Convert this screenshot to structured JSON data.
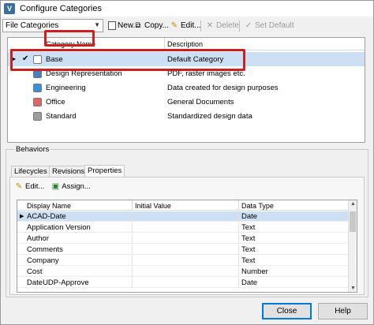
{
  "window": {
    "title": "Configure Categories",
    "app_icon": "vault-icon"
  },
  "toolbar": {
    "combo_value": "File Categories",
    "new_label": "New...",
    "copy_label": "Copy...",
    "edit_label": "Edit...",
    "delete_label": "Delete",
    "set_default_label": "Set Default"
  },
  "categories": {
    "headers": [
      "Category Name",
      "Description"
    ],
    "rows": [
      {
        "name": "Base",
        "description": "Default Category",
        "color": "#ffffff",
        "selected": true
      },
      {
        "name": "Design Representation",
        "description": "PDF, raster images etc.",
        "color": "#4a7ebf",
        "selected": false
      },
      {
        "name": "Engineering",
        "description": "Data created for design purposes",
        "color": "#3b8fd6",
        "selected": false
      },
      {
        "name": "Office",
        "description": "General Documents",
        "color": "#e06666",
        "selected": false
      },
      {
        "name": "Standard",
        "description": "Standardized design data",
        "color": "#9e9e9e",
        "selected": false
      }
    ]
  },
  "behaviors": {
    "legend": "Behaviors",
    "tabs": [
      "Lifecycles",
      "Revisions",
      "Properties"
    ],
    "active_tab": "Properties",
    "edit_label": "Edit...",
    "assign_label": "Assign...",
    "headers": [
      "Display Name",
      "Initial Value",
      "Data Type"
    ],
    "rows": [
      {
        "name": "ACAD-Date",
        "initial": "",
        "type": "Date",
        "selected": true
      },
      {
        "name": "Application Version",
        "initial": "",
        "type": "Text",
        "selected": false
      },
      {
        "name": "Author",
        "initial": "",
        "type": "Text",
        "selected": false
      },
      {
        "name": "Comments",
        "initial": "",
        "type": "Text",
        "selected": false
      },
      {
        "name": "Company",
        "initial": "",
        "type": "Text",
        "selected": false
      },
      {
        "name": "Cost",
        "initial": "",
        "type": "Number",
        "selected": false
      },
      {
        "name": "DateUDP-Approve",
        "initial": "",
        "type": "Date",
        "selected": false
      }
    ]
  },
  "buttons": {
    "close_label": "Close",
    "help_label": "Help"
  },
  "colors": {
    "selection": "#cde0f3",
    "highlight": "#cc1f1f"
  }
}
